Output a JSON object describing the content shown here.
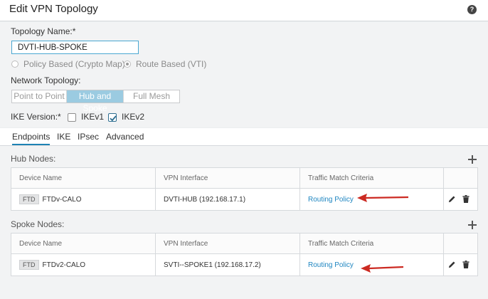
{
  "header": {
    "title": "Edit VPN Topology",
    "help_icon": "?"
  },
  "form": {
    "topology_name_label": "Topology Name:*",
    "topology_name_value": "DVTI-HUB-SPOKE",
    "vpn_type": {
      "options": [
        "Policy Based (Crypto Map)",
        "Route Based (VTI)"
      ],
      "selected": "Route Based (VTI)"
    },
    "network_topology_label": "Network Topology:",
    "network_topology": {
      "options": [
        "Point to Point",
        "Hub and Spoke",
        "Full Mesh"
      ],
      "selected": "Hub and Spoke"
    },
    "ike_version_label": "IKE Version:*",
    "ike": {
      "ikev1_label": "IKEv1",
      "ikev1_checked": false,
      "ikev2_label": "IKEv2",
      "ikev2_checked": true
    }
  },
  "tabs": [
    {
      "label": "Endpoints",
      "active": true
    },
    {
      "label": "IKE",
      "active": false
    },
    {
      "label": "IPsec",
      "active": false
    },
    {
      "label": "Advanced",
      "active": false
    }
  ],
  "table_headers": {
    "device": "Device Name",
    "interface": "VPN Interface",
    "criteria": "Traffic Match Criteria"
  },
  "hub_nodes": {
    "label": "Hub Nodes:",
    "rows": [
      {
        "badge": "FTD",
        "device": "FTDv-CALO",
        "interface": "DVTI-HUB (192.168.17.1)",
        "criteria": "Routing Policy"
      }
    ]
  },
  "spoke_nodes": {
    "label": "Spoke Nodes:",
    "rows": [
      {
        "badge": "FTD",
        "device": "FTDv2-CALO",
        "interface": "SVTI--SPOKE1 (192.168.17.2)",
        "criteria": "Routing Policy"
      }
    ]
  },
  "colors": {
    "accent": "#1e82b4",
    "selected_segment": "#9bcbe1",
    "annotation_arrow": "#cc2a22",
    "link": "#1f86c1"
  }
}
